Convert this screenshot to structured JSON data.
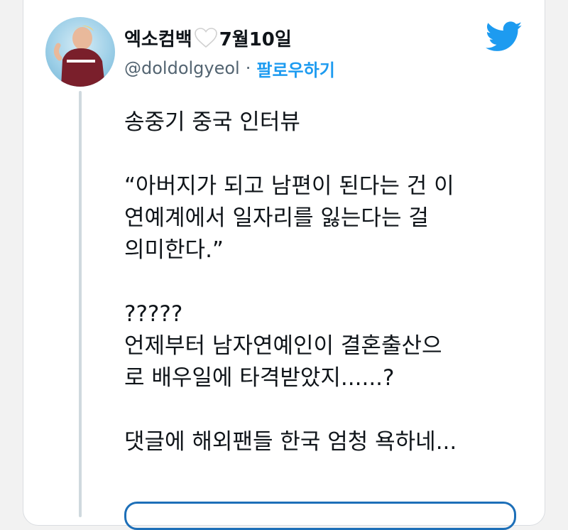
{
  "tweet": {
    "display_name": "엑소컴백",
    "date": "7월10일",
    "handle": "@doldolgyeol",
    "separator": "·",
    "follow_label": "팔로우하기",
    "body": {
      "line1": "송중기 중국 인터뷰",
      "line2": "“아버지가 되고 남편이 된다는 건 이",
      "line3": "연예계에서 일자리를 잃는다는 걸",
      "line4": "의미한다.”",
      "line5": "?????",
      "line6": "언제부터 남자연예인이 결혼출산으",
      "line7": "로 배우일에 타격받았지......?",
      "line8": "댓글에 해외팬들 한국 엄청 욕하네..."
    }
  },
  "icons": {
    "heart": "white-heart-icon",
    "brand": "twitter-bird-icon"
  },
  "colors": {
    "accent": "#1d9bf0",
    "text": "#0f1419",
    "secondary": "#536471"
  }
}
